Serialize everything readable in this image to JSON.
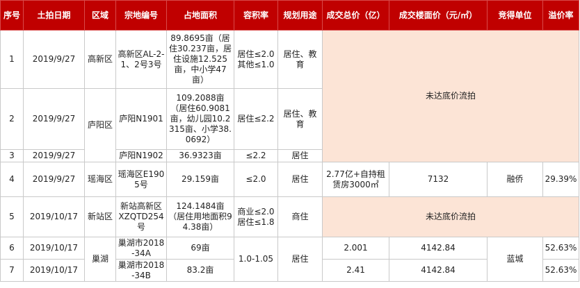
{
  "headers": [
    "序号",
    "土拍日期",
    "区域",
    "宗地编号",
    "占地面积",
    "容积率",
    "规划用途",
    "成交总价（亿）",
    "成交楼面价（元/㎡）",
    "竞得单位",
    "溢价率"
  ],
  "rows": [
    {
      "no": "1",
      "date": "2019/9/27",
      "district": "高新区",
      "parcel": "高新区AL-2-1、2号3号",
      "area": "89.8695亩（居住30.237亩，居住设施12.525亩，中小学47亩）",
      "far": [
        "居住≤2.0",
        "其他≤1.0"
      ],
      "use": "居住、教育"
    },
    {
      "no": "2",
      "date": "2019/9/27",
      "district": "庐阳区",
      "parcel": "庐阳N1901",
      "area": "109.2088亩（居住60.9081亩，幼儿园10.2315亩、小学38.0692）",
      "far": [
        "居住≤2.2"
      ],
      "use": "居住、教育"
    },
    {
      "no": "3",
      "date": "2019/9/27",
      "parcel": "庐阳N1902",
      "area": "36.9323亩",
      "far": [
        "≤2.2"
      ],
      "use": "居住"
    },
    {
      "no": "4",
      "date": "2019/9/27",
      "district": "瑶海区",
      "parcel": "瑶海区E1905号",
      "area": "29.159亩",
      "far": [
        "≤2.0"
      ],
      "use": "居住",
      "total": "2.77亿+自持租赁房3000㎡",
      "price": "7132",
      "winner": "融侨",
      "premium": "29.39%"
    },
    {
      "no": "5",
      "date": "2019/10/17",
      "district": "新站区",
      "parcel": "新站高新区XZQTD254号",
      "area": "124.1484亩（居住用地面积94.38亩）",
      "far": [
        "商业≤2.0",
        "居住≤1.8"
      ],
      "use": "商住"
    },
    {
      "no": "6",
      "date": "2019/10/17",
      "district": "巢湖",
      "parcel": "巢湖市2018-34A",
      "area": "69亩",
      "far": [
        "1.0-1.05"
      ],
      "use": "居住",
      "total": "2.001",
      "price": "4142.84",
      "winner": "蓝城",
      "premium": "52.63%"
    },
    {
      "no": "7",
      "date": "2019/10/17",
      "parcel": "巢湖市2018-34B",
      "area": "83.2亩",
      "total": "2.41",
      "price": "4142.84",
      "premium": "52.63%"
    }
  ],
  "failed_text": "未达底价流拍",
  "colors": {
    "header_bg": "#c00000",
    "header_text": "#ffffff",
    "failed_bg": "#fce4d6",
    "border": "#c9c9c9"
  }
}
